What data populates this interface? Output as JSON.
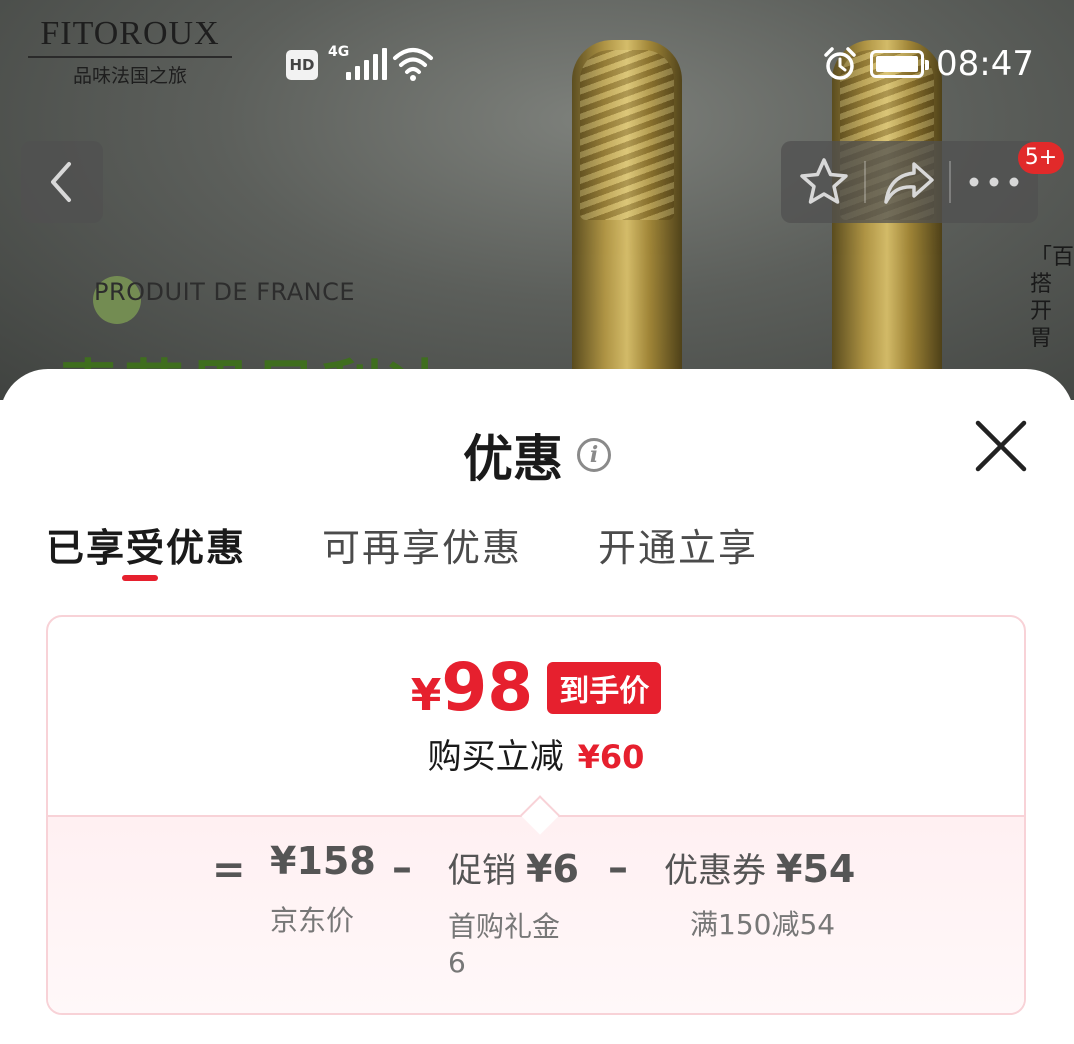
{
  "hero": {
    "brand_name": "FITOROUX",
    "brand_tagline": "品味法国之旅",
    "produit": "PRODUIT DE FRANCE",
    "vertical_text": "「百搭开胃"
  },
  "status_bar": {
    "hd": "HD",
    "network": "4G",
    "time": "08:47"
  },
  "nav": {
    "cart_badge": "5+"
  },
  "sheet": {
    "title": "优惠",
    "tabs": [
      {
        "label": "已享受优惠",
        "active": true
      },
      {
        "label": "可再享优惠",
        "active": false
      },
      {
        "label": "开通立享",
        "active": false
      }
    ],
    "card": {
      "currency": "¥",
      "final_price": "98",
      "final_price_tag": "到手价",
      "reduce_label": "购买立减",
      "reduce_amount": "¥60",
      "breakdown": {
        "equals": "=",
        "minus": "–",
        "jd_price": "¥158",
        "jd_price_label": "京东价",
        "promo_label": "促销",
        "promo_value": "¥6",
        "promo_sub_line1": "首购礼金",
        "promo_sub_line2": "6",
        "coupon_label": "优惠券",
        "coupon_value": "¥54",
        "coupon_sub": "满150减54"
      }
    }
  },
  "colors": {
    "accent_red": "#e6202e",
    "card_border": "#f8d2d7",
    "breakdown_bg": "#fff0f2"
  }
}
